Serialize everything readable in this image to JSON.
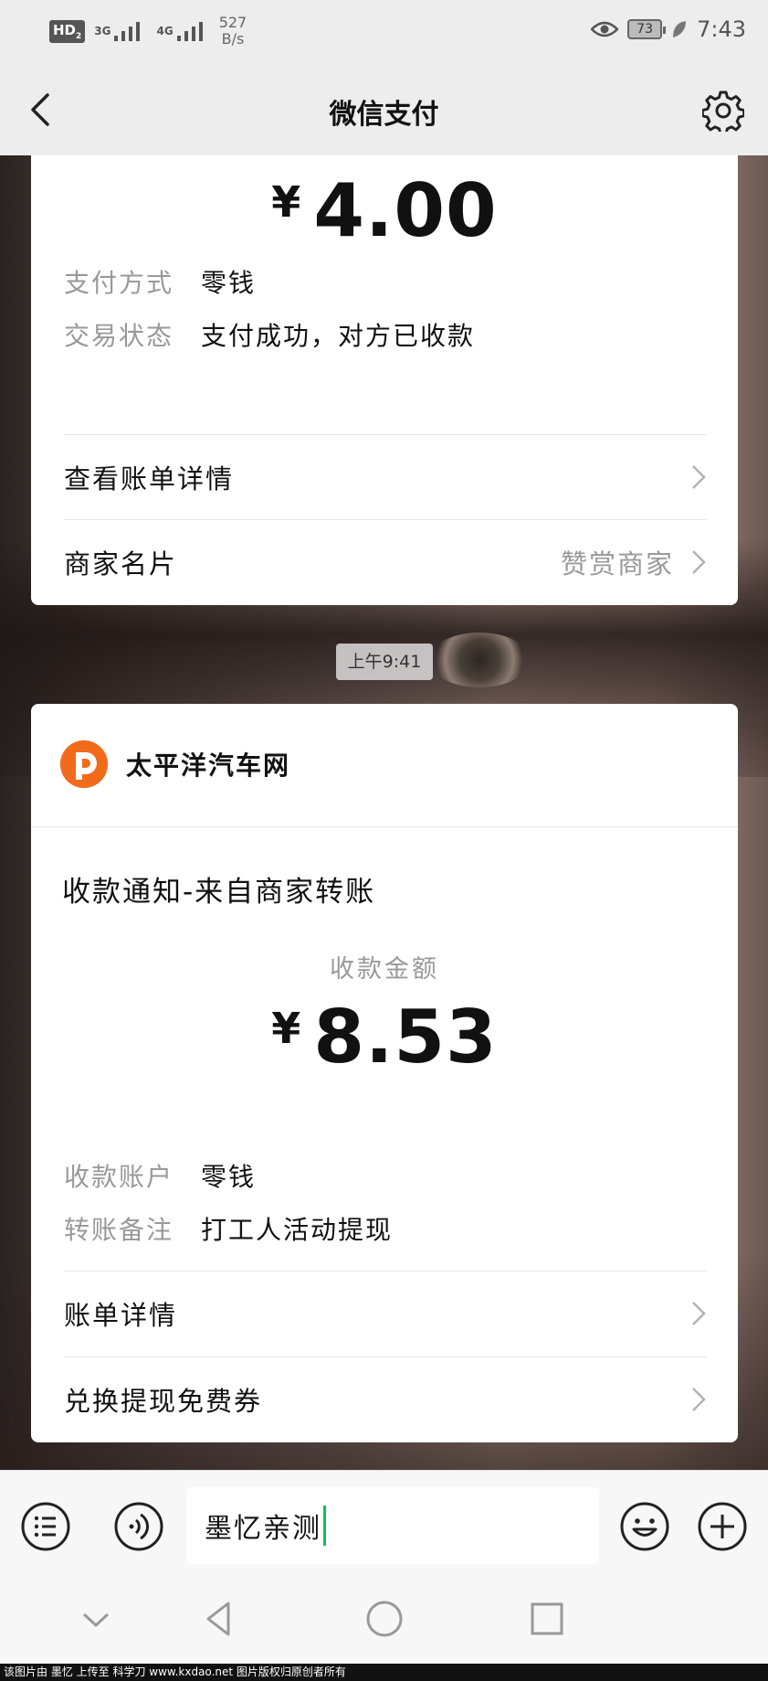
{
  "status_bar": {
    "hd": "HD",
    "hd_sub": "2",
    "sig1": "3G",
    "sig2": "4G",
    "net_speed_value": "527",
    "net_speed_unit": "B/s",
    "battery": "73",
    "time": "7:43"
  },
  "nav": {
    "title": "微信支付"
  },
  "card1": {
    "currency": "¥",
    "amount": "4.00",
    "details": [
      {
        "key": "支付方式",
        "value": "零钱"
      },
      {
        "key": "交易状态",
        "value": "支付成功，对方已收款"
      }
    ],
    "rows": [
      {
        "label": "查看账单详情",
        "extra": ""
      },
      {
        "label": "商家名片",
        "extra": "赞赏商家"
      }
    ]
  },
  "timestamp": "上午9:41",
  "card2": {
    "merchant_name": "太平洋汽车网",
    "notice_title": "收款通知-来自商家转账",
    "amount_caption": "收款金额",
    "currency": "¥",
    "amount": "8.53",
    "details": [
      {
        "key": "收款账户",
        "value": "零钱"
      },
      {
        "key": "转账备注",
        "value": "打工人活动提现"
      }
    ],
    "rows": [
      {
        "label": "账单详情"
      },
      {
        "label": "兑换提现免费券"
      }
    ]
  },
  "input": {
    "value": "墨忆亲测"
  },
  "footer": "该图片由 墨忆 上传至 科学刀 www.kxdao.net 图片版权归原创者所有",
  "colors": {
    "accent_green": "#07c160",
    "logo_orange": "#f26a1b"
  }
}
